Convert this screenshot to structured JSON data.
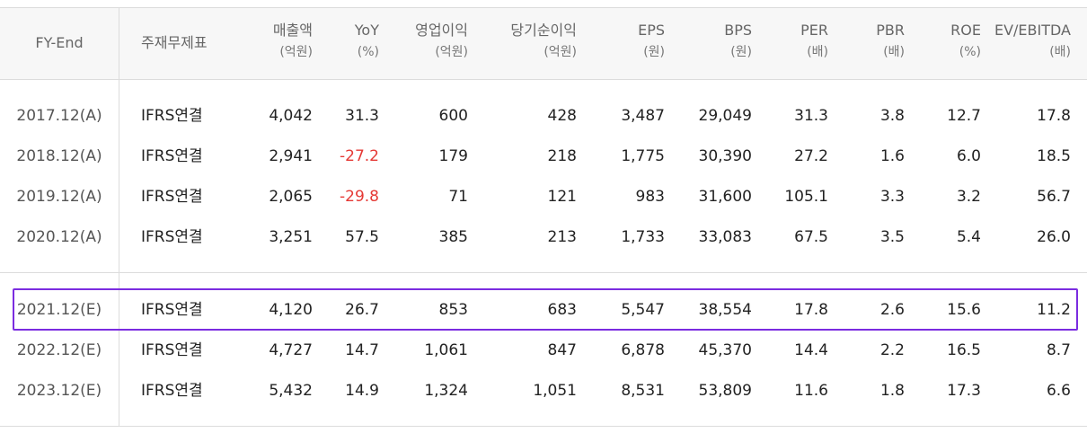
{
  "header": {
    "fy_end": "FY-End",
    "statement": "주재무제표",
    "cols": [
      {
        "main": "매출액",
        "sub": "(억원)"
      },
      {
        "main": "YoY",
        "sub": "(%)"
      },
      {
        "main": "영업이익",
        "sub": "(억원)"
      },
      {
        "main": "당기순이익",
        "sub": "(억원)"
      },
      {
        "main": "EPS",
        "sub": "(원)"
      },
      {
        "main": "BPS",
        "sub": "(원)"
      },
      {
        "main": "PER",
        "sub": "(배)"
      },
      {
        "main": "PBR",
        "sub": "(배)"
      },
      {
        "main": "ROE",
        "sub": "(%)"
      },
      {
        "main": "EV/EBITDA",
        "sub": "(배)"
      }
    ]
  },
  "rows": [
    {
      "fy": "2017.12(A)",
      "stmt": "IFRS연결",
      "sales": "4,042",
      "yoy": "31.3",
      "op": "600",
      "net": "428",
      "eps": "3,487",
      "bps": "29,049",
      "per": "31.3",
      "pbr": "3.8",
      "roe": "12.7",
      "ev": "17.8"
    },
    {
      "fy": "2018.12(A)",
      "stmt": "IFRS연결",
      "sales": "2,941",
      "yoy": "-27.2",
      "op": "179",
      "net": "218",
      "eps": "1,775",
      "bps": "30,390",
      "per": "27.2",
      "pbr": "1.6",
      "roe": "6.0",
      "ev": "18.5"
    },
    {
      "fy": "2019.12(A)",
      "stmt": "IFRS연결",
      "sales": "2,065",
      "yoy": "-29.8",
      "op": "71",
      "net": "121",
      "eps": "983",
      "bps": "31,600",
      "per": "105.1",
      "pbr": "3.3",
      "roe": "3.2",
      "ev": "56.7"
    },
    {
      "fy": "2020.12(A)",
      "stmt": "IFRS연결",
      "sales": "3,251",
      "yoy": "57.5",
      "op": "385",
      "net": "213",
      "eps": "1,733",
      "bps": "33,083",
      "per": "67.5",
      "pbr": "3.5",
      "roe": "5.4",
      "ev": "26.0"
    },
    {
      "fy": "2021.12(E)",
      "stmt": "IFRS연결",
      "sales": "4,120",
      "yoy": "26.7",
      "op": "853",
      "net": "683",
      "eps": "5,547",
      "bps": "38,554",
      "per": "17.8",
      "pbr": "2.6",
      "roe": "15.6",
      "ev": "11.2"
    },
    {
      "fy": "2022.12(E)",
      "stmt": "IFRS연결",
      "sales": "4,727",
      "yoy": "14.7",
      "op": "1,061",
      "net": "847",
      "eps": "6,878",
      "bps": "45,370",
      "per": "14.4",
      "pbr": "2.2",
      "roe": "16.5",
      "ev": "8.7"
    },
    {
      "fy": "2023.12(E)",
      "stmt": "IFRS연결",
      "sales": "5,432",
      "yoy": "14.9",
      "op": "1,324",
      "net": "1,051",
      "eps": "8,531",
      "bps": "53,809",
      "per": "11.6",
      "pbr": "1.8",
      "roe": "17.3",
      "ev": "6.6"
    }
  ],
  "colors": {
    "negative": "#e53935",
    "highlight_border": "#7b2ce0"
  }
}
